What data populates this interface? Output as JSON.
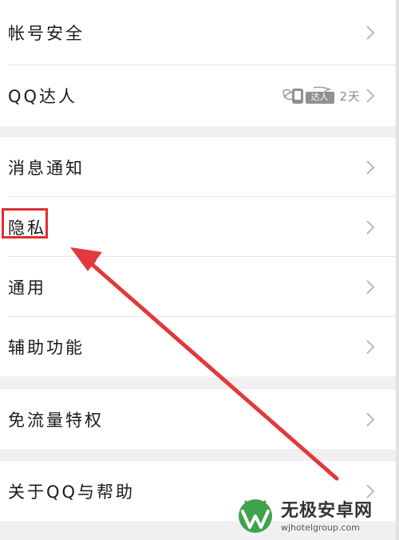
{
  "settings": {
    "groups": [
      {
        "items": [
          {
            "label": "帐号安全"
          },
          {
            "label": "QQ达人",
            "badge_text": "达人",
            "days": "2天"
          }
        ]
      },
      {
        "items": [
          {
            "label": "消息通知"
          },
          {
            "label": "隐私",
            "highlighted": true
          },
          {
            "label": "通用"
          },
          {
            "label": "辅助功能"
          }
        ]
      },
      {
        "items": [
          {
            "label": "免流量特权"
          }
        ]
      },
      {
        "items": [
          {
            "label": "关于QQ与帮助"
          }
        ]
      }
    ]
  },
  "annotation": {
    "highlight_color": "#e02e2e",
    "arrow_color": "#e03a3a"
  },
  "watermark": {
    "name": "无极安卓网",
    "url": "wjhotelgroup.com"
  },
  "icons": {
    "chevron": "chevron-right-icon",
    "badge": "qq-daren-badge-icon",
    "logo": "watermark-logo-icon"
  }
}
